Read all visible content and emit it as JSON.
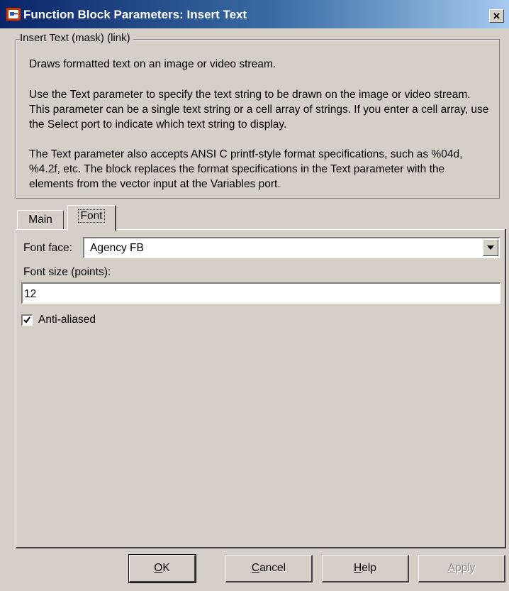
{
  "window": {
    "title": "Function Block Parameters: Insert Text",
    "close_symbol": "×",
    "icon": "simulink-block-icon"
  },
  "group": {
    "legend": "Insert Text (mask) (link)",
    "paragraphs": [
      "Draws formatted text on an image or video stream.",
      "Use the Text parameter to specify the text string to be drawn on the image or video stream. This parameter can be a single text string or a cell array of strings. If you enter a cell array, use the Select port to indicate which text string to display.",
      "The Text parameter also accepts ANSI C printf-style format specifications, such as %04d, %4.2f, etc. The block replaces the format specifications in the Text parameter with the elements from the vector input at the Variables port."
    ]
  },
  "tabs": [
    {
      "label": "Main",
      "active": false
    },
    {
      "label": "Font",
      "active": true
    }
  ],
  "font_tab": {
    "font_face_label": "Font face:",
    "font_face_value": "Agency FB",
    "font_size_label": "Font size (points):",
    "font_size_value": "12",
    "antialiased_label": "Anti-aliased",
    "antialiased_checked": true
  },
  "buttons": {
    "ok": {
      "mnemonic": "O",
      "rest": "K"
    },
    "cancel": {
      "mnemonic": "C",
      "rest": "ancel"
    },
    "help": {
      "mnemonic": "H",
      "rest": "elp"
    },
    "apply": {
      "mnemonic": "A",
      "rest": "pply",
      "enabled": false
    }
  }
}
